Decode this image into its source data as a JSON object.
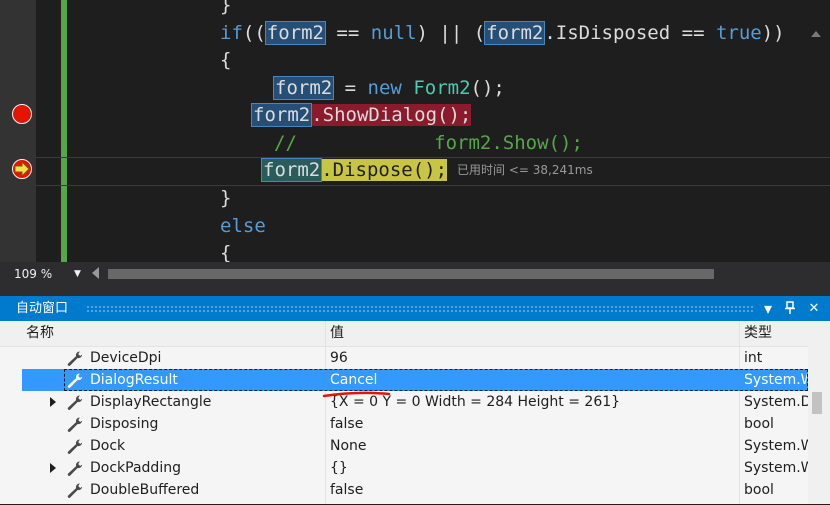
{
  "editor": {
    "lines": {
      "close_brace_top": "}",
      "if_kw": "if",
      "if_open": "((",
      "if_var1": "form2",
      "if_eq1": " == ",
      "if_null": "null",
      "if_mid": ") || (",
      "if_var2": "form2",
      "if_prop": ".IsDisposed == ",
      "if_true": "true",
      "if_close": "))",
      "open_brace": "{",
      "assign_var": "form2",
      "assign_eq": " = ",
      "assign_new": "new",
      "assign_cls": "Form2",
      "assign_end": "();",
      "showdialog_var": "form2",
      "showdialog_call": ".ShowDialog();",
      "comment_slashes": "//",
      "comment_text": "form2.Show();",
      "dispose_var": "form2",
      "dispose_call": ".Dispose();",
      "elapsed": "已用时间 <= 38,241ms",
      "close_brace": "}",
      "else_kw": "else",
      "open_brace2": "{"
    },
    "zoom": "109 %"
  },
  "autos": {
    "title": "自动窗口",
    "buttons": {
      "dropdown": "▾",
      "pin": "⊥",
      "close": "✕"
    },
    "columns": {
      "name": "名称",
      "value": "值",
      "type": "类型"
    },
    "rows": [
      {
        "name": "DeviceDpi",
        "value": "96",
        "type": "int",
        "expand": false
      },
      {
        "name": "DialogResult",
        "value": "Cancel",
        "type": "System.W",
        "expand": false,
        "selected": true
      },
      {
        "name": "DisplayRectangle",
        "value": "{X = 0 Y = 0 Width = 284 Height = 261}",
        "type": "System.D",
        "expand": true
      },
      {
        "name": "Disposing",
        "value": "false",
        "type": "bool",
        "expand": false
      },
      {
        "name": "Dock",
        "value": "None",
        "type": "System.W",
        "expand": false
      },
      {
        "name": "DockPadding",
        "value": "{}",
        "type": "System.W",
        "expand": true
      },
      {
        "name": "DoubleBuffered",
        "value": "false",
        "type": "bool",
        "expand": false
      }
    ]
  },
  "colors": {
    "accent": "#007acc",
    "selection": "#3399ff",
    "breakpoint": "#e51400",
    "current_statement": "#c9c544",
    "annotation_underline": "#e51400"
  },
  "icons": [
    "breakpoint-icon",
    "current-statement-breakpoint-icon",
    "wrench-icon",
    "expand-arrow-icon",
    "pin-icon",
    "close-icon",
    "dropdown-icon"
  ]
}
